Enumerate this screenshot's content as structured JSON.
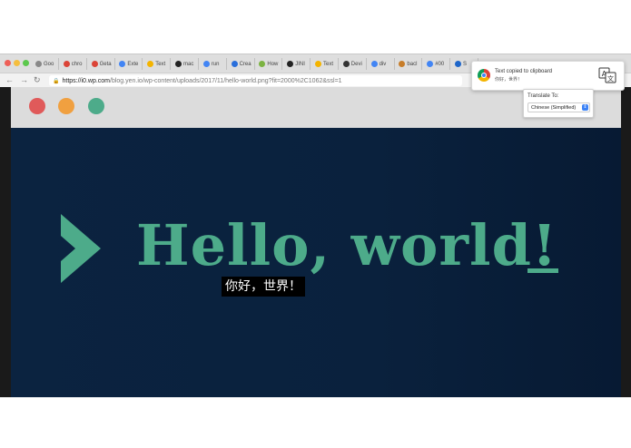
{
  "browser": {
    "tabs": [
      {
        "label": "Goo",
        "icon": "code-icon",
        "color": "#888888"
      },
      {
        "label": "chro",
        "icon": "chrome-icon",
        "color": "#db4437"
      },
      {
        "label": "Geta",
        "icon": "chrome-icon",
        "color": "#db4437"
      },
      {
        "label": "Exte",
        "icon": "puzzle-icon",
        "color": "#4285f4"
      },
      {
        "label": "Text",
        "icon": "drive-icon",
        "color": "#f4b400"
      },
      {
        "label": "mac",
        "icon": "github-icon",
        "color": "#222222"
      },
      {
        "label": "run",
        "icon": "google-icon",
        "color": "#4285f4"
      },
      {
        "label": "Crea",
        "icon": "npm-icon",
        "color": "#2a6fdb"
      },
      {
        "label": "How",
        "icon": "image-icon",
        "color": "#7cb342"
      },
      {
        "label": "JINI",
        "icon": "github-icon",
        "color": "#222222"
      },
      {
        "label": "Text",
        "icon": "drive-icon",
        "color": "#f4b400"
      },
      {
        "label": "Devi",
        "icon": "circle-icon",
        "color": "#333333"
      },
      {
        "label": "div",
        "icon": "google-icon",
        "color": "#4285f4"
      },
      {
        "label": "bacl",
        "icon": "pen-icon",
        "color": "#c77d2a"
      },
      {
        "label": "#00",
        "icon": "google-icon",
        "color": "#4285f4"
      },
      {
        "label": "S",
        "icon": "box-icon",
        "color": "#1e66c9"
      }
    ],
    "url": {
      "host": "https://i0.wp.com",
      "path": "/blog.yen.io/wp-content/uploads/2017/11/hello-world.png?fit=2000%2C1062&ssl=1"
    }
  },
  "page": {
    "heading": "Hello, world!",
    "subtitle": "你好，世界！",
    "dot_colors": [
      "#e05a5a",
      "#f0a040",
      "#4dab8a"
    ],
    "accent": "#4dab8a"
  },
  "notification": {
    "title": "Text copied to clipboard",
    "body": "你好，世界！"
  },
  "translate_menu": {
    "label": "Translate To:",
    "selected": "Chinese (Simplified)"
  }
}
